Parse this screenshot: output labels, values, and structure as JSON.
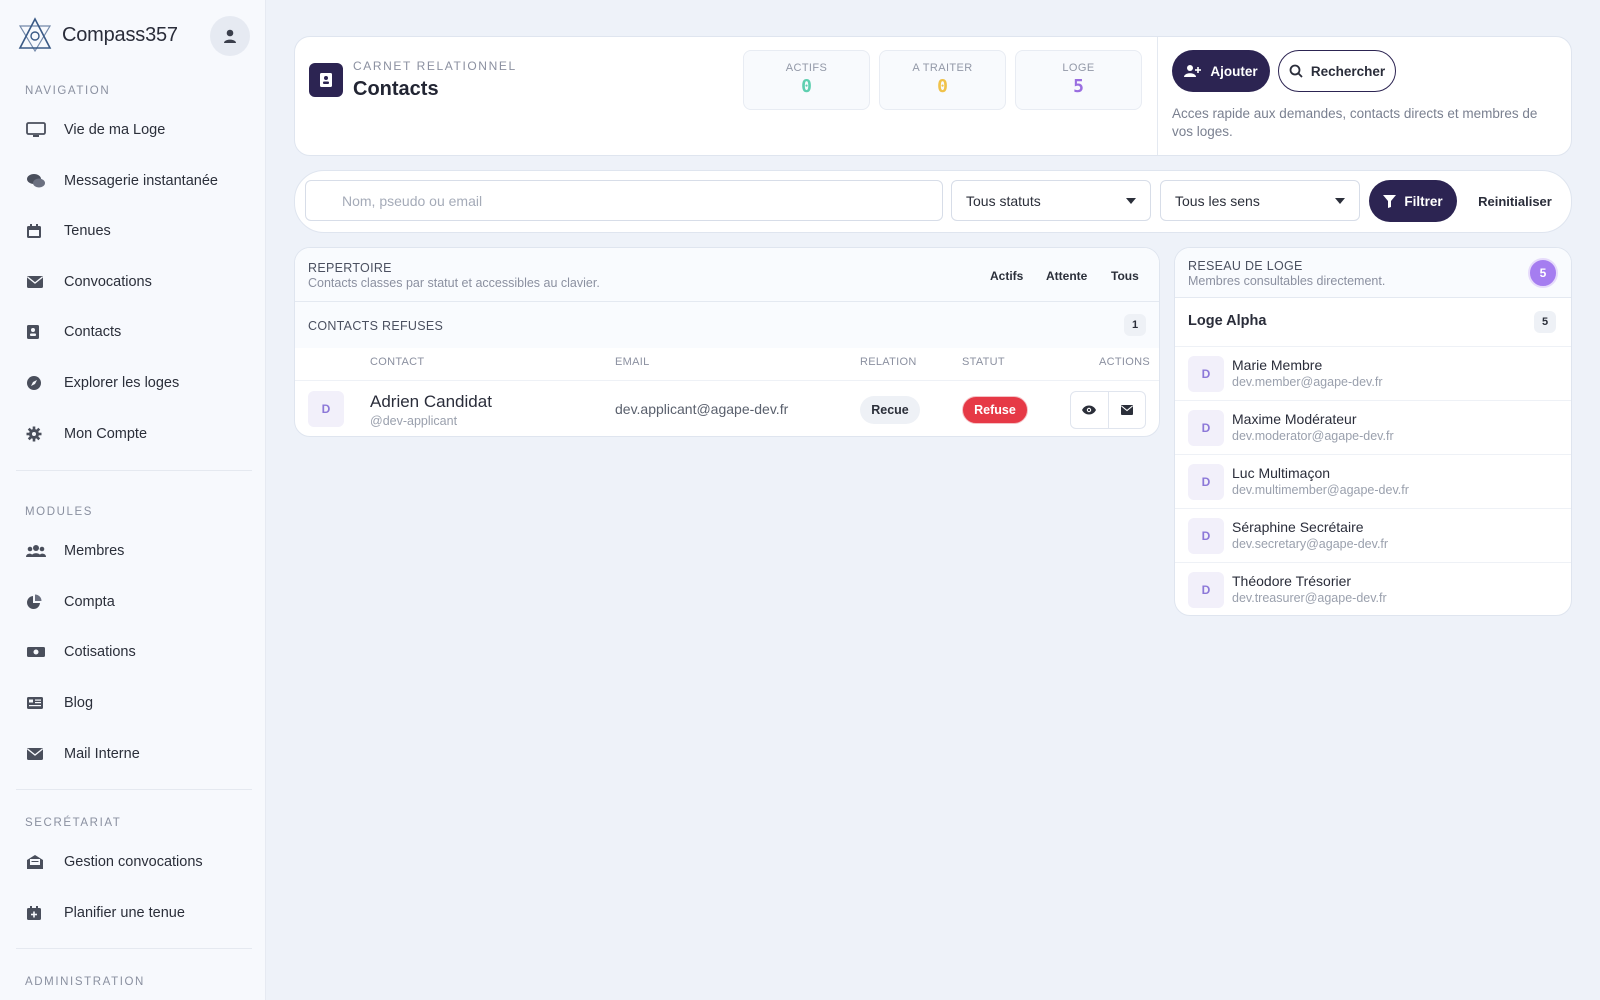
{
  "sidebar": {
    "brand": "Compass357",
    "sections": [
      {
        "title": "NAVIGATION"
      },
      {
        "title": "MODULES"
      },
      {
        "title": "SECRÉTARIAT"
      },
      {
        "title": "ADMINISTRATION"
      }
    ],
    "nav": [
      {
        "label": "Vie de ma Loge",
        "icon": "monitor-icon"
      },
      {
        "label": "Messagerie instantanée",
        "icon": "chat-icon"
      },
      {
        "label": "Tenues",
        "icon": "calendar-icon"
      },
      {
        "label": "Convocations",
        "icon": "envelope-icon"
      },
      {
        "label": "Contacts",
        "icon": "address-book-icon"
      },
      {
        "label": "Explorer les loges",
        "icon": "compass-icon"
      },
      {
        "label": "Mon Compte",
        "icon": "gear-icon"
      }
    ],
    "modules": [
      {
        "label": "Membres",
        "icon": "users-icon"
      },
      {
        "label": "Compta",
        "icon": "pie-chart-icon"
      },
      {
        "label": "Cotisations",
        "icon": "money-icon"
      },
      {
        "label": "Blog",
        "icon": "newspaper-icon"
      },
      {
        "label": "Mail Interne",
        "icon": "envelope-icon"
      }
    ],
    "secretariat": [
      {
        "label": "Gestion convocations",
        "icon": "envelope-open-icon"
      },
      {
        "label": "Planifier une tenue",
        "icon": "calendar-plus-icon"
      }
    ]
  },
  "header": {
    "eyebrow": "CARNET RELATIONNEL",
    "title": "Contacts",
    "stats": [
      {
        "label": "ACTIFS",
        "value": "0",
        "color": "#5fcfb0"
      },
      {
        "label": "A TRAITER",
        "value": "0",
        "color": "#f0c24a"
      },
      {
        "label": "LOGE",
        "value": "5",
        "color": "#9a6ee0"
      }
    ],
    "add_label": "Ajouter",
    "search_label": "Rechercher",
    "description": "Acces rapide aux demandes, contacts directs et membres de vos loges."
  },
  "filters": {
    "search_placeholder": "Nom, pseudo ou email",
    "status_value": "Tous statuts",
    "direction_value": "Tous les sens",
    "filter_label": "Filtrer",
    "reset_label": "Reinitialiser"
  },
  "repertoire": {
    "title": "REPERTOIRE",
    "subtitle": "Contacts classes par statut et accessibles au clavier.",
    "tabs": [
      "Actifs",
      "Attente",
      "Tous"
    ],
    "group_title": "CONTACTS REFUSES",
    "group_count": "1",
    "columns": [
      "CONTACT",
      "EMAIL",
      "RELATION",
      "STATUT",
      "ACTIONS"
    ],
    "rows": [
      {
        "initial": "D",
        "name": "Adrien Candidat",
        "handle": "@dev-applicant",
        "email": "dev.applicant@agape-dev.fr",
        "relation": "Recue",
        "status": "Refuse"
      }
    ]
  },
  "network": {
    "title": "RESEAU DE LOGE",
    "subtitle": "Membres consultables directement.",
    "badge": "5",
    "lodge": {
      "name": "Loge Alpha",
      "count": "5"
    },
    "members": [
      {
        "initial": "D",
        "name": "Marie Membre",
        "email": "dev.member@agape-dev.fr"
      },
      {
        "initial": "D",
        "name": "Maxime Modérateur",
        "email": "dev.moderator@agape-dev.fr"
      },
      {
        "initial": "D",
        "name": "Luc Multimaçon",
        "email": "dev.multimember@agape-dev.fr"
      },
      {
        "initial": "D",
        "name": "Séraphine Secrétaire",
        "email": "dev.secretary@agape-dev.fr"
      },
      {
        "initial": "D",
        "name": "Théodore Trésorier",
        "email": "dev.treasurer@agape-dev.fr"
      }
    ]
  }
}
